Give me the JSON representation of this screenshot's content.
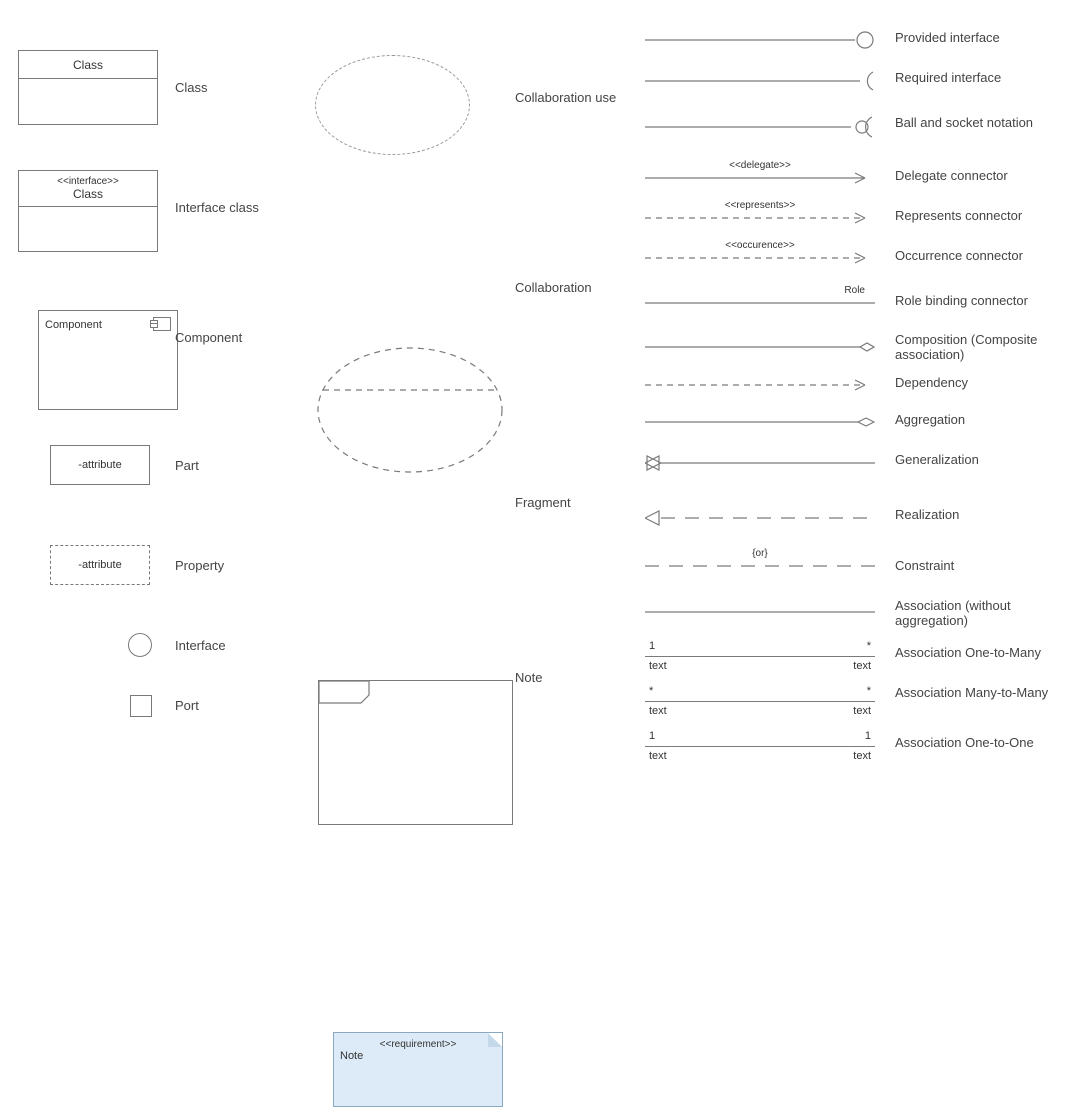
{
  "col1": {
    "class": {
      "title": "Class",
      "label": "Class"
    },
    "interfaceClass": {
      "stereotype": "<<interface>>",
      "title": "Class",
      "label": "Interface class"
    },
    "component": {
      "title": "Component",
      "label": "Component"
    },
    "part": {
      "text": "-attribute",
      "label": "Part"
    },
    "property": {
      "text": "-attribute",
      "label": "Property"
    },
    "interface": {
      "label": "Interface"
    },
    "port": {
      "label": "Port"
    }
  },
  "col2": {
    "collabUse": {
      "label": "Collaboration use"
    },
    "collab": {
      "label": "Collaboration"
    },
    "fragment": {
      "label": "Fragment"
    },
    "note": {
      "stereotype": "<<requirement>>",
      "text": "Note",
      "label": "Note"
    }
  },
  "connectors": {
    "provided": "Provided interface",
    "required": "Required interface",
    "ballSocket": "Ball and socket notation",
    "delegate": {
      "stereo": "<<delegate>>",
      "label": "Delegate connector"
    },
    "represents": {
      "stereo": "<<represents>>",
      "label": "Represents connector"
    },
    "occurrence": {
      "stereo": "<<occurence>>",
      "label": "Occurrence connector"
    },
    "roleBinding": {
      "role": "Role",
      "label": "Role binding connector"
    },
    "composition": "Composition (Composite association)",
    "dependency": "Dependency",
    "aggregation": "Aggregation",
    "generalization": "Generalization",
    "realization": "Realization",
    "constraint": {
      "text": "{or}",
      "label": "Constraint"
    },
    "association": "Association (without aggregation)",
    "assocOneMany": {
      "left": "1",
      "right": "*",
      "bl": "text",
      "br": "text",
      "label": "Association One-to-Many"
    },
    "assocManyMany": {
      "left": "*",
      "right": "*",
      "bl": "text",
      "br": "text",
      "label": "Association Many-to-Many"
    },
    "assocOneOne": {
      "left": "1",
      "right": "1",
      "bl": "text",
      "br": "text",
      "label": "Association One-to-One"
    }
  }
}
